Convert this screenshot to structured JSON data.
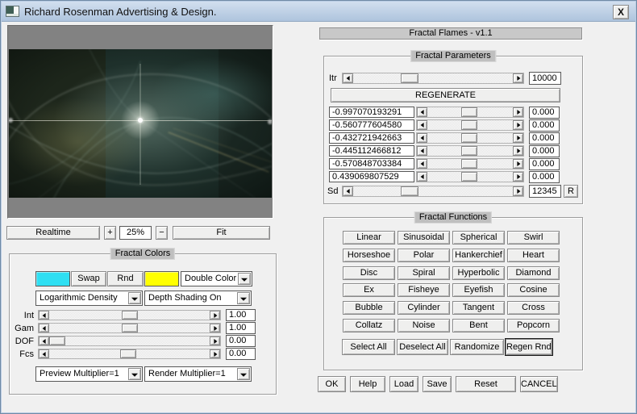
{
  "window": {
    "title": "Richard Rosenman Advertising & Design.",
    "close": "X"
  },
  "app_header": {
    "title": "Fractal Flames - v1.1"
  },
  "zoom_controls": {
    "realtime": "Realtime",
    "zoom_in": "+",
    "zoom_level": "25%",
    "zoom_out": "−",
    "fit": "Fit"
  },
  "fractal_colors": {
    "title": "Fractal Colors",
    "swatch_a_color": "#2fdff2",
    "swatch_b_color": "#ffff00",
    "swap_label": "Swap",
    "rnd_label": "Rnd",
    "double_color": "Double Color",
    "density": "Logarithmic Density",
    "depth_shading": "Depth Shading On",
    "preview_multiplier": "Preview Multiplier=1",
    "render_multiplier": "Render Multiplier=1",
    "sliders": [
      {
        "label": "Int",
        "value": "1.00",
        "thumb": "45%"
      },
      {
        "label": "Gam",
        "value": "1.00",
        "thumb": "45%"
      },
      {
        "label": "DOF",
        "value": "0.00",
        "thumb": "0%"
      },
      {
        "label": "Fcs",
        "value": "0.00",
        "thumb": "44%"
      }
    ]
  },
  "fractal_parameters": {
    "title": "Fractal Parameters",
    "itr_label": "Itr",
    "itr_value": "10000",
    "itr_thumb": "30%",
    "regenerate_label": "REGENERATE",
    "params": [
      {
        "value": "-0.997070193291",
        "delta": "0.000",
        "thumb": "40%"
      },
      {
        "value": "-0.560777604580",
        "delta": "0.000",
        "thumb": "40%"
      },
      {
        "value": "-0.432721942663",
        "delta": "0.000",
        "thumb": "40%"
      },
      {
        "value": "-0.445112466812",
        "delta": "0.000",
        "thumb": "40%"
      },
      {
        "value": "-0.570848703384",
        "delta": "0.000",
        "thumb": "40%"
      },
      {
        "value": "0.439069807529",
        "delta": "0.000",
        "thumb": "40%"
      }
    ],
    "sd_label": "Sd",
    "sd_value": "12345",
    "sd_thumb": "30%",
    "r_label": "R"
  },
  "fractal_functions": {
    "title": "Fractal Functions",
    "functions": [
      "Linear",
      "Sinusoidal",
      "Spherical",
      "Swirl",
      "Horseshoe",
      "Polar",
      "Hankerchief",
      "Heart",
      "Disc",
      "Spiral",
      "Hyperbolic",
      "Diamond",
      "Ex",
      "Fisheye",
      "Eyefish",
      "Cosine",
      "Bubble",
      "Cylinder",
      "Tangent",
      "Cross",
      "Collatz",
      "Noise",
      "Bent",
      "Popcorn"
    ],
    "actions": [
      {
        "label": "Select All"
      },
      {
        "label": "Deselect All"
      },
      {
        "label": "Randomize"
      },
      {
        "label": "Regen Rnd",
        "default": true
      }
    ]
  },
  "dialog_buttons": [
    "OK",
    "Help",
    "Load",
    "Save",
    "Reset",
    "CANCEL"
  ]
}
